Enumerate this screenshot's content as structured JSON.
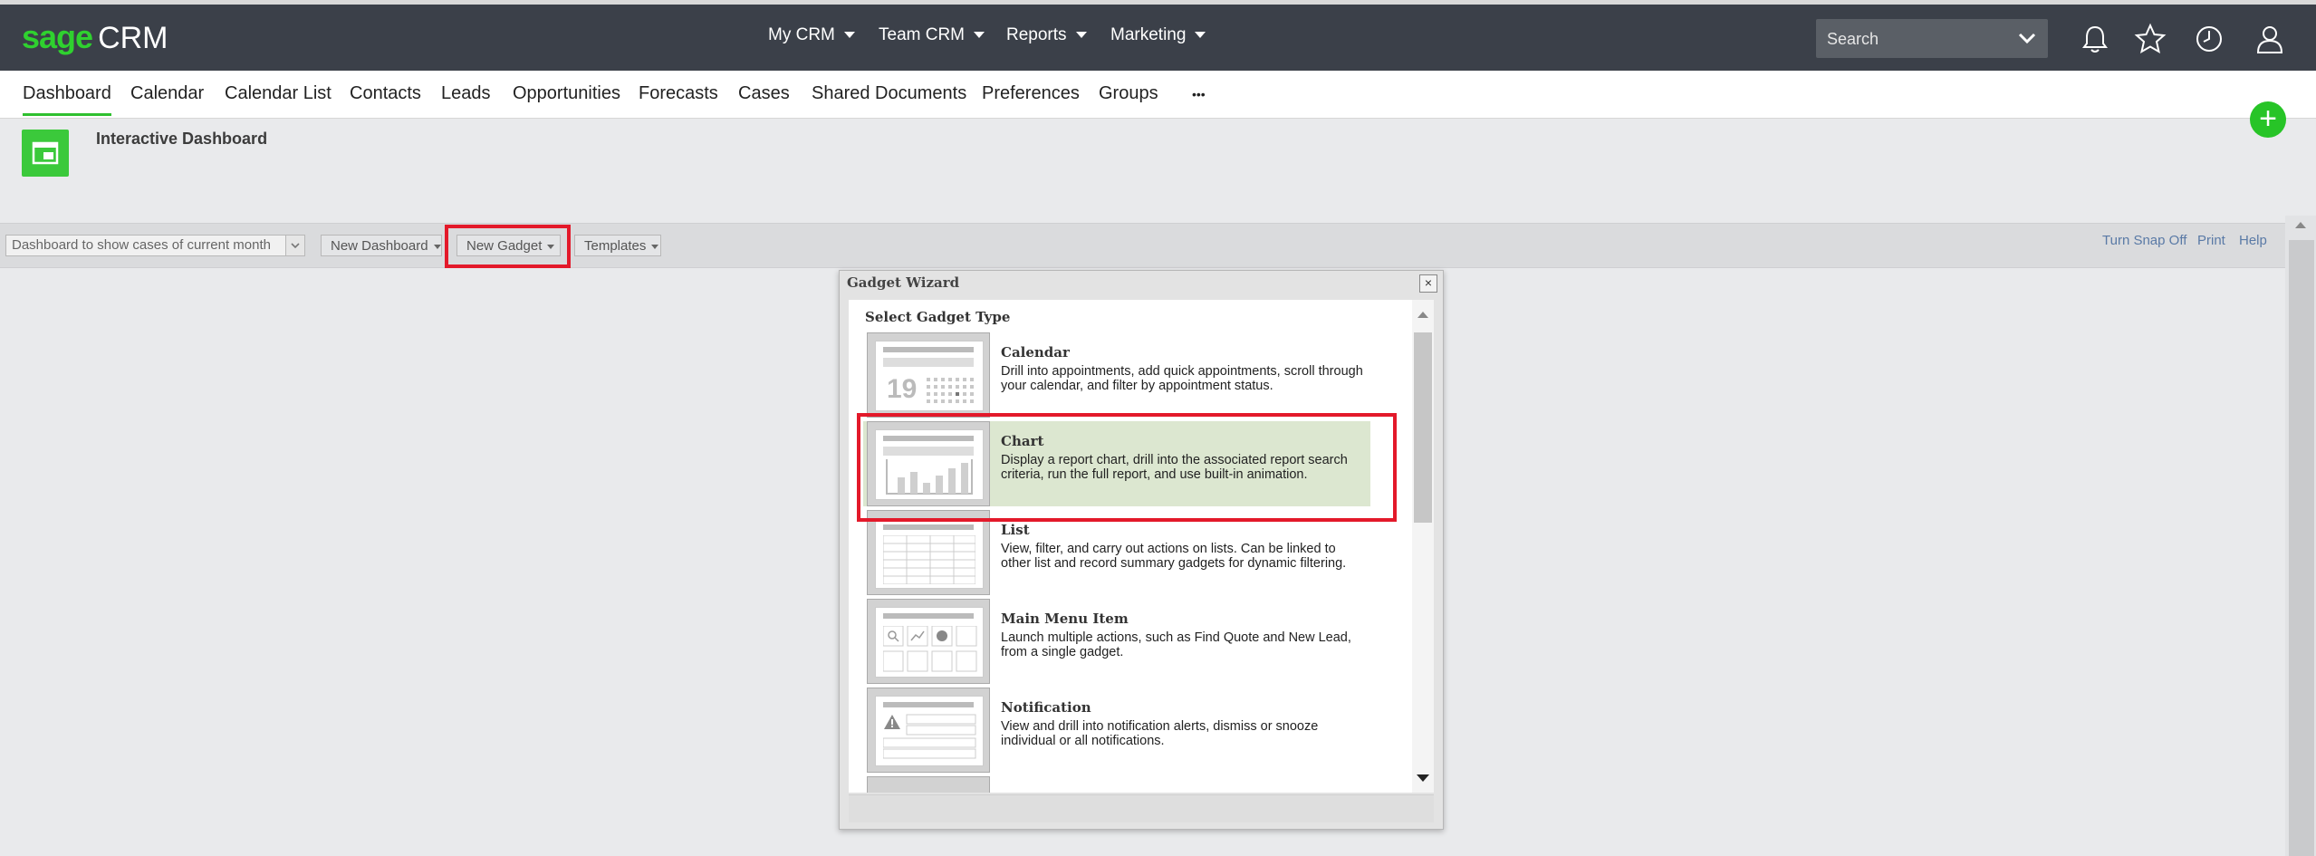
{
  "brand": {
    "name_green": "sage",
    "name_white": "CRM",
    "accent": "#2fd12f"
  },
  "top_nav": [
    {
      "label": "My CRM"
    },
    {
      "label": "Team CRM"
    },
    {
      "label": "Reports"
    },
    {
      "label": "Marketing"
    }
  ],
  "search": {
    "placeholder": "Search"
  },
  "top_icons": [
    "bell-icon",
    "star-icon",
    "clock-icon",
    "user-icon"
  ],
  "tabs": [
    {
      "label": "Dashboard",
      "active": true
    },
    {
      "label": "Calendar"
    },
    {
      "label": "Calendar List"
    },
    {
      "label": "Contacts"
    },
    {
      "label": "Leads"
    },
    {
      "label": "Opportunities"
    },
    {
      "label": "Forecasts"
    },
    {
      "label": "Cases"
    },
    {
      "label": "Shared Documents"
    },
    {
      "label": "Preferences"
    },
    {
      "label": "Groups"
    },
    {
      "label": "•••"
    }
  ],
  "page": {
    "title": "Interactive Dashboard"
  },
  "toolbar": {
    "dashboard_select": "Dashboard to show cases of current month",
    "new_dashboard": "New Dashboard",
    "new_gadget": "New Gadget",
    "templates": "Templates",
    "links": [
      "Turn Snap Off",
      "Print",
      "Help"
    ]
  },
  "wizard": {
    "title": "Gadget Wizard",
    "close": "×",
    "heading": "Select Gadget Type",
    "calendar_day": "19",
    "items": [
      {
        "name": "Calendar",
        "desc": "Drill into appointments, add quick appointments, scroll through your calendar, and filter by appointment status."
      },
      {
        "name": "Chart",
        "desc": "Display a report chart, drill into the associated report search criteria, run the full report, and use built-in animation.",
        "selected": true
      },
      {
        "name": "List",
        "desc": "View, filter, and carry out actions on lists. Can be linked to other list and record summary gadgets for dynamic filtering."
      },
      {
        "name": "Main Menu Item",
        "desc": "Launch multiple actions, such as Find Quote and New Lead, from a single gadget."
      },
      {
        "name": "Notification",
        "desc": "View and drill into notification alerts, dismiss or snooze individual or all notifications."
      }
    ]
  },
  "highlight_color": "#e3192a"
}
